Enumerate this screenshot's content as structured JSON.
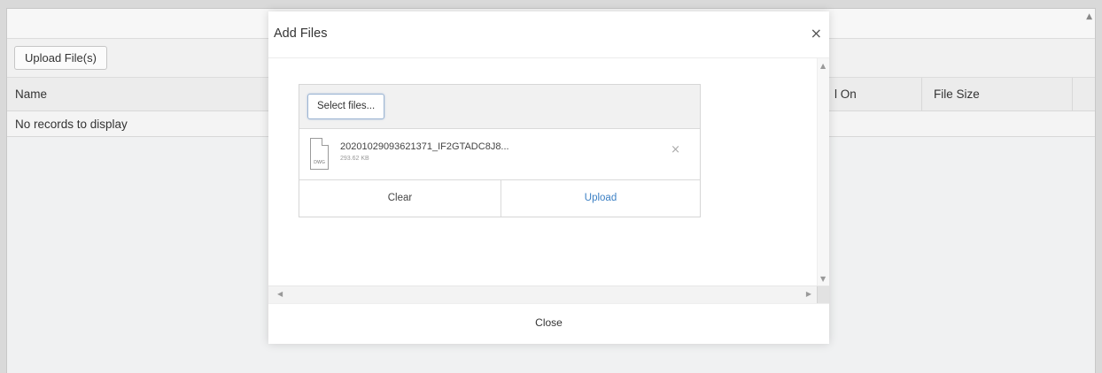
{
  "page": {
    "toolbar": {
      "upload_label": "Upload File(s)"
    },
    "grid": {
      "columns": [
        "Name",
        "l On",
        "File Size"
      ],
      "empty_text": "No records to display"
    }
  },
  "modal": {
    "title": "Add Files",
    "close_x": "×",
    "select_files_label": "Select files...",
    "file": {
      "name": "20201029093621371_IF2GTADC8J8...",
      "size": "293.62 KB",
      "ext": "DWG"
    },
    "remove_x": "×",
    "clear_label": "Clear",
    "upload_label": "Upload",
    "close_label": "Close"
  },
  "colors": {
    "link_blue": "#3b7fc4",
    "select_border": "#9db5d3"
  }
}
